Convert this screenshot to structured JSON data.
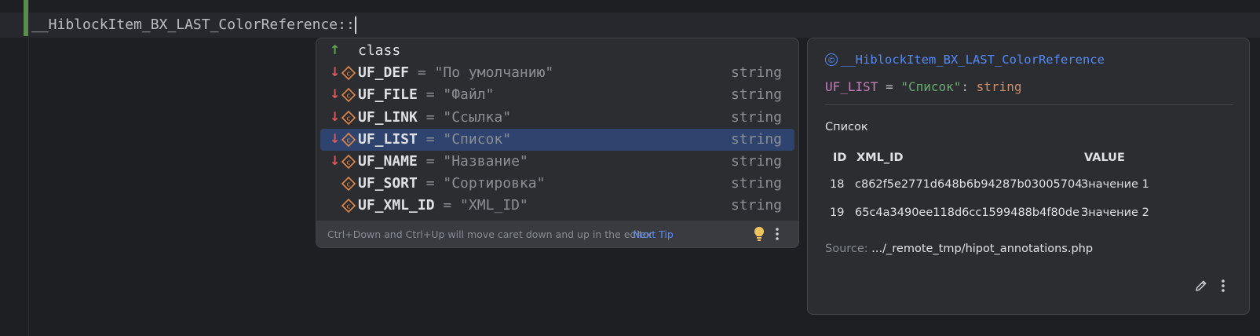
{
  "editor": {
    "code_text": "__HiblockItem_BX_LAST_ColorReference::"
  },
  "completion": {
    "items": [
      {
        "name": "class",
        "tail": "",
        "type": "",
        "arrow": "up",
        "icon": "none",
        "selected": false
      },
      {
        "name": "UF_DEF",
        "tail": " = \"По умолчанию\"",
        "type": "string",
        "arrow": "down",
        "icon": "constant-icon",
        "selected": false
      },
      {
        "name": "UF_FILE",
        "tail": " = \"Файл\"",
        "type": "string",
        "arrow": "down",
        "icon": "constant-icon",
        "selected": false
      },
      {
        "name": "UF_LINK",
        "tail": " = \"Ссылка\"",
        "type": "string",
        "arrow": "down",
        "icon": "constant-icon",
        "selected": false
      },
      {
        "name": "UF_LIST",
        "tail": " = \"Список\"",
        "type": "string",
        "arrow": "down",
        "icon": "constant-icon",
        "selected": true
      },
      {
        "name": "UF_NAME",
        "tail": " = \"Название\"",
        "type": "string",
        "arrow": "down",
        "icon": "constant-icon",
        "selected": false
      },
      {
        "name": "UF_SORT",
        "tail": " = \"Сортировка\"",
        "type": "string",
        "arrow": "none",
        "icon": "constant-icon",
        "selected": false
      },
      {
        "name": "UF_XML_ID",
        "tail": " = \"XML_ID\"",
        "type": "string",
        "arrow": "none",
        "icon": "constant-icon",
        "selected": false
      }
    ],
    "footer_text": "Ctrl+Down and Ctrl+Up will move caret down and up in the editor",
    "next_tip": "Next Tip"
  },
  "doc": {
    "class_icon": "©",
    "title": "__HiblockItem_BX_LAST_ColorReference",
    "sig_name": "UF_LIST",
    "sig_eq": " = ",
    "sig_value": "\"Список\"",
    "sig_colon": ": ",
    "sig_type": "string",
    "description": "Список",
    "table": {
      "headers": [
        "ID",
        "XML_ID",
        "VALUE"
      ],
      "rows": [
        [
          "18",
          "c862f5e2771d648b6b94287b03005704",
          "Значение 1"
        ],
        [
          "19",
          "65c4a3490ee118d6cc1599488b4f80de",
          "Значение 2"
        ]
      ]
    },
    "source_label": "Source:",
    "source_path": ".../_remote_tmp/hipot_annotations.php"
  },
  "colors": {
    "background": "#1e1f22",
    "popup": "#2b2d30",
    "selection": "#2e436e",
    "link": "#548af7",
    "string_value": "#6aab73",
    "constant": "#c77dbb",
    "type": "#cf8e6d"
  }
}
